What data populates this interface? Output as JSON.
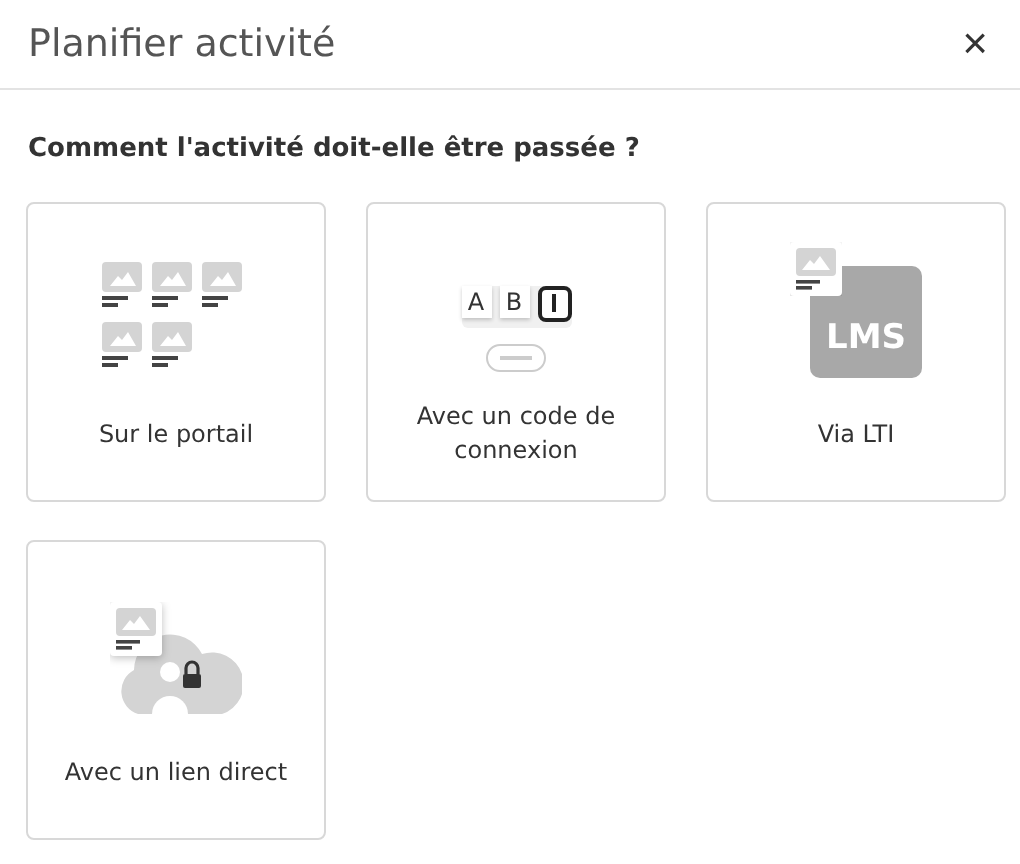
{
  "dialog": {
    "title": "Planifier activité",
    "close": "×"
  },
  "question": "Comment l'activité doit-elle être passée ?",
  "options": [
    {
      "kind": "portal",
      "label": "Sur le portail"
    },
    {
      "kind": "code",
      "label": "Avec un code de connexion",
      "keys": [
        "A",
        "B"
      ]
    },
    {
      "kind": "lti",
      "label": "Via LTI",
      "badge": "LMS"
    },
    {
      "kind": "link",
      "label": "Avec un lien direct"
    }
  ]
}
